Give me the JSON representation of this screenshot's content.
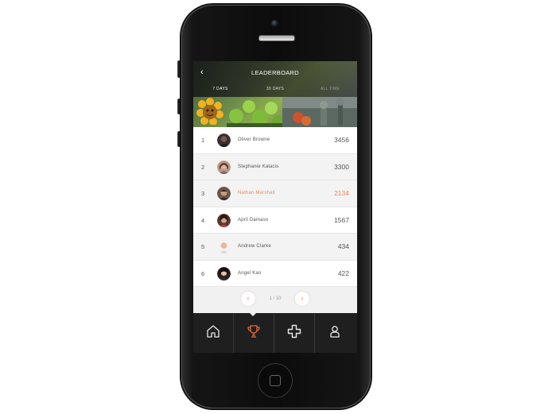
{
  "header": {
    "title": "LEADERBOARD",
    "back_icon": "chevron-left-icon"
  },
  "tabs": [
    {
      "label": "7 DAYS",
      "active": true
    },
    {
      "label": "30 DAYS",
      "active": false
    },
    {
      "label": "ALL TIME",
      "active": false
    }
  ],
  "leaderboard": [
    {
      "rank": "1",
      "name": "Oliver Browne",
      "score": "3456",
      "highlight": false
    },
    {
      "rank": "2",
      "name": "Stephanie Kalacis",
      "score": "3300",
      "highlight": false
    },
    {
      "rank": "3",
      "name": "Nathan Marshall",
      "score": "2134",
      "highlight": true
    },
    {
      "rank": "4",
      "name": "April Damaso",
      "score": "1567",
      "highlight": false
    },
    {
      "rank": "5",
      "name": "Andrew Clarke",
      "score": "434",
      "highlight": false
    },
    {
      "rank": "6",
      "name": "Angel Kao",
      "score": "422",
      "highlight": false
    }
  ],
  "pagination": {
    "text": "1 / 10",
    "prev_icon": "chevron-left-icon",
    "next_icon": "chevron-right-icon"
  },
  "nav": [
    {
      "name": "home",
      "icon": "home-icon",
      "active": false
    },
    {
      "name": "leaderboard",
      "icon": "trophy-icon",
      "active": true
    },
    {
      "name": "games",
      "icon": "gamepad-icon",
      "active": false
    },
    {
      "name": "profile",
      "icon": "user-icon",
      "active": false
    }
  ],
  "colors": {
    "accent": "#e46a3a",
    "highlight_text": "#e68b5e",
    "nav_bg": "#1f1f1f"
  }
}
